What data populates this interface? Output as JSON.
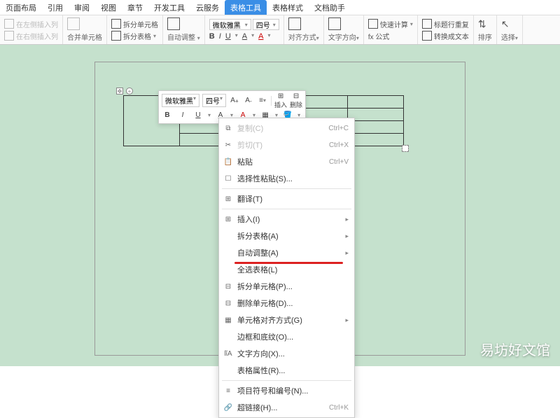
{
  "tabs": [
    "页面布局",
    "引用",
    "审阅",
    "视图",
    "章节",
    "开发工具",
    "云服务",
    "表格工具",
    "表格样式",
    "文档助手"
  ],
  "activeTab": 7,
  "ribbon": {
    "insLeft": "在左侧插入列",
    "insRight": "在右侧插入列",
    "merge": "合并单元格",
    "splitCell": "拆分单元格",
    "splitTable": "拆分表格",
    "autoFit": "自动调整",
    "font": "微软雅黑",
    "size": "四号",
    "alignMode": "对齐方式",
    "textDir": "文字方向",
    "formula": "fx 公式",
    "quickCalc": "快速计算",
    "titleRepeat": "标题行重复",
    "toText": "转换成文本",
    "sort": "排序",
    "select": "选择"
  },
  "floatToolbar": {
    "font": "微软雅黑",
    "size": "四号",
    "insert": "插入",
    "delete": "删除"
  },
  "contextMenu": [
    {
      "icon": "⧉",
      "label": "复制(C)",
      "shortcut": "Ctrl+C",
      "disabled": true
    },
    {
      "icon": "✂",
      "label": "剪切(T)",
      "shortcut": "Ctrl+X",
      "disabled": true
    },
    {
      "icon": "📋",
      "label": "粘贴",
      "shortcut": "Ctrl+V"
    },
    {
      "icon": "☐",
      "label": "选择性粘贴(S)..."
    },
    {
      "sep": true
    },
    {
      "icon": "⊞",
      "label": "翻译(T)"
    },
    {
      "sep": true
    },
    {
      "icon": "⊞",
      "label": "插入(I)",
      "submenu": true
    },
    {
      "label": "拆分表格(A)",
      "submenu": true
    },
    {
      "label": "自动调整(A)",
      "submenu": true
    },
    {
      "label": "全选表格(L)"
    },
    {
      "icon": "⊟",
      "label": "拆分单元格(P)...",
      "highlight": true
    },
    {
      "icon": "⊟",
      "label": "删除单元格(D)..."
    },
    {
      "icon": "▦",
      "label": "单元格对齐方式(G)",
      "submenu": true
    },
    {
      "label": "边框和底纹(O)..."
    },
    {
      "icon": "lǐA",
      "label": "文字方向(X)..."
    },
    {
      "label": "表格属性(R)..."
    },
    {
      "sep": true
    },
    {
      "icon": "≡",
      "label": "项目符号和编号(N)..."
    },
    {
      "icon": "🔗",
      "label": "超链接(H)...",
      "shortcut": "Ctrl+K"
    }
  ],
  "watermark": "易坊好文馆"
}
